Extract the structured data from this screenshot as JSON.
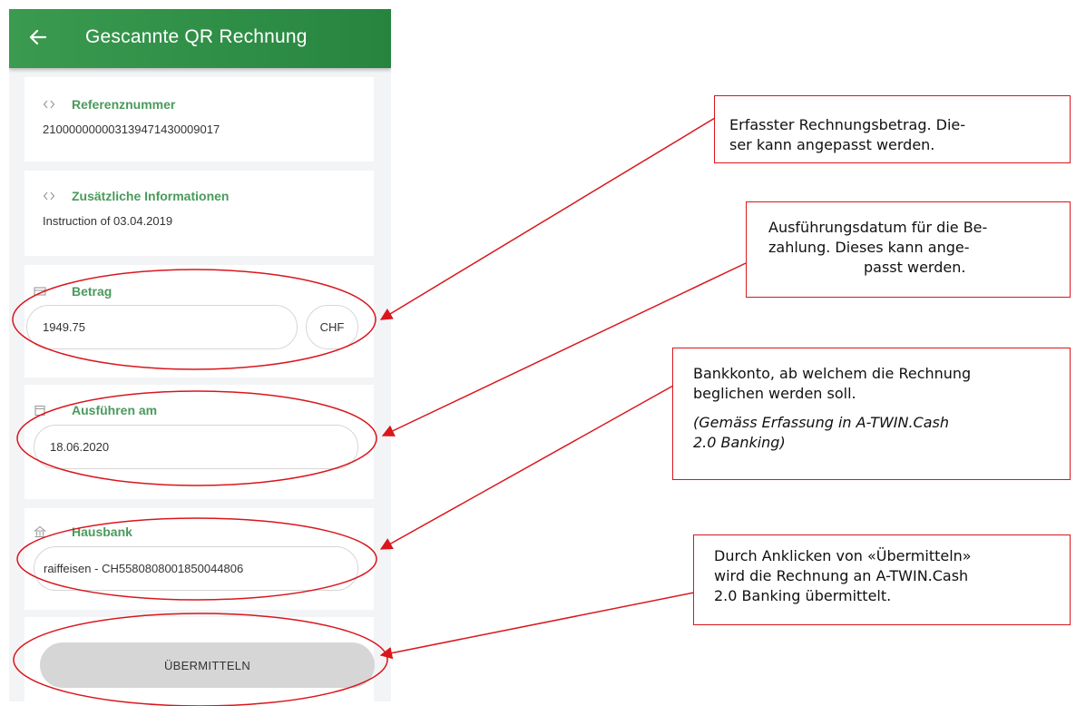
{
  "appbar": {
    "title": "Gescannte QR Rechnung",
    "back_icon": "arrow-left-icon",
    "color": "#2f8f47"
  },
  "reference": {
    "label": "Referenznummer",
    "value": "210000000003139471430009017",
    "icon": "code-brackets-icon"
  },
  "info": {
    "label": "Zusätzliche Informationen",
    "value": "Instruction of 03.04.2019",
    "icon": "code-brackets-icon"
  },
  "amount": {
    "label": "Betrag",
    "value": "1949.75",
    "currency": "CHF",
    "icon": "money-icon"
  },
  "execute": {
    "label": "Ausführen am",
    "value": "18.06.2020",
    "icon": "calendar-icon"
  },
  "bank": {
    "label": "Hausbank",
    "value": "raiffeisen - CH5580808001850044806",
    "icon": "bank-icon"
  },
  "submit": {
    "label": "ÜBERMITTELN"
  },
  "annotations": {
    "amount": "Erfasster Rechnungsbetrag. Dieser kann angepasst werden.",
    "amount_lines": [
      "Erfasster Rechnungsbetrag. Die-",
      "ser kann angepasst werden."
    ],
    "date_lines": [
      "Ausführungsdatum für die Be-",
      "zahlung. Dieses kann ange-",
      "passt werden."
    ],
    "bank_lines": [
      "Bankkonto, ab welchem die Rechnung",
      "beglichen werden soll."
    ],
    "bank_note_lines": [
      "(Gemäss Erfassung in A-TWIN.Cash",
      "2.0 Banking)"
    ],
    "submit_lines": [
      "Durch Anklicken von «Übermitteln»",
      "wird die Rechnung an A-TWIN.Cash",
      "2.0 Banking übermittelt."
    ],
    "accent_color": "#d9161c"
  }
}
